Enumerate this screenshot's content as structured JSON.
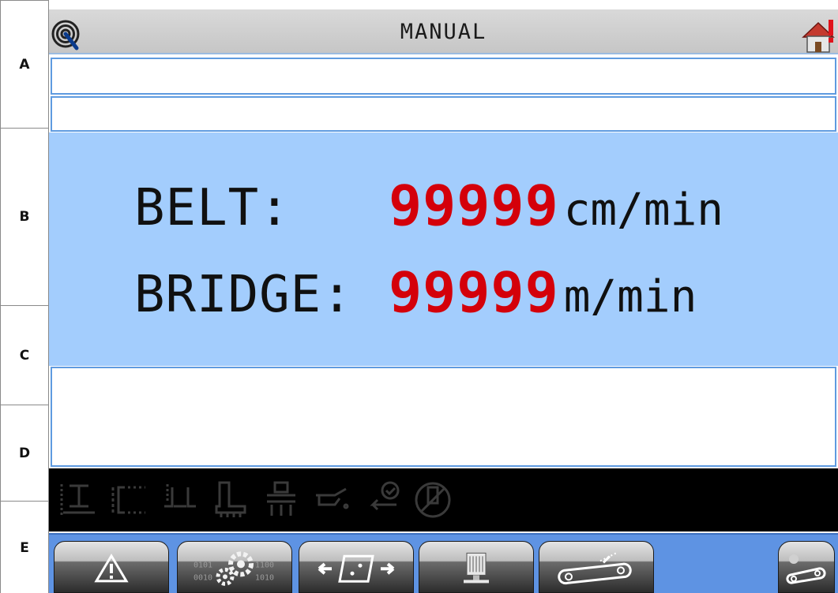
{
  "side_labels": [
    "A",
    "B",
    "C",
    "D",
    "E"
  ],
  "header": {
    "title": "MANUAL"
  },
  "readouts": {
    "belt": {
      "label": "BELT:",
      "value": "99999",
      "unit": "cm/min"
    },
    "bridge": {
      "label": "BRIDGE:",
      "value": "99999",
      "unit": "m/min"
    }
  },
  "colors": {
    "panel_blue": "#a3cdfd",
    "value_red": "#d4000a",
    "toolbar_blue": "#5e93e3",
    "field_border": "#5f9be0"
  },
  "status_icons": [
    "beam-lift-icon",
    "bracket-adjust-icon",
    "width-adjust-icon",
    "brush-icon",
    "spray-nozzles-icon",
    "oil-can-icon",
    "return-check-icon",
    "disabled-tool-icon"
  ],
  "toolbar": {
    "buttons": [
      "alarm-warning-button",
      "settings-gears-button",
      "translate-plate-button",
      "motor-button",
      "belt-speed-button",
      "conveyor-toggle-button"
    ],
    "gear_bits": [
      "0101",
      "1100",
      "0010",
      "1010"
    ]
  }
}
